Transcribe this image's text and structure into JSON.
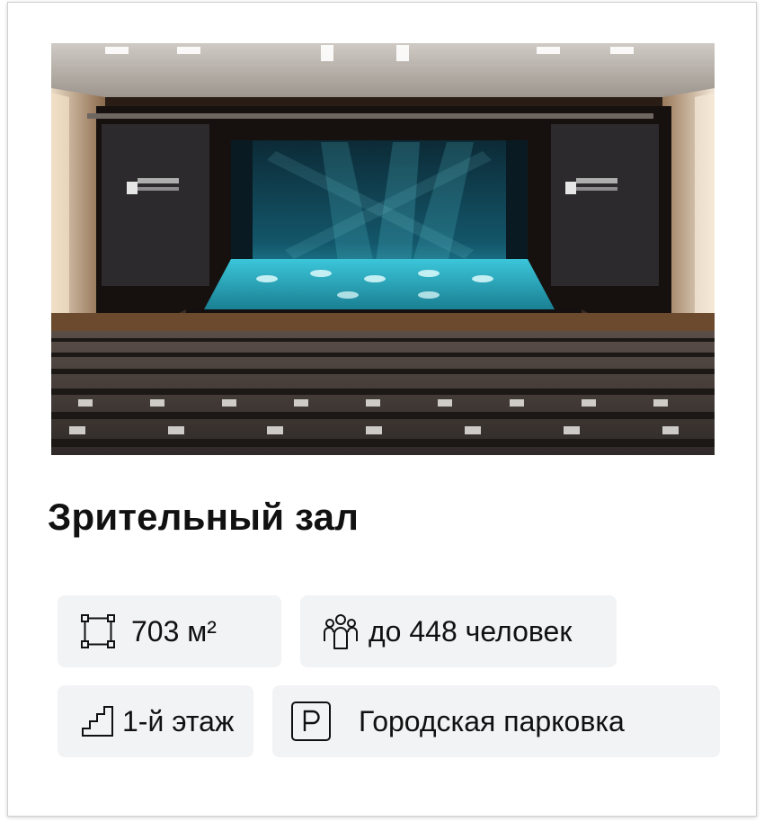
{
  "venue": {
    "photo_alt": "Зрительный зал",
    "title": "Зрительный зал"
  },
  "features": {
    "area": {
      "icon": "area-square-icon",
      "label": "703 м²"
    },
    "capacity": {
      "icon": "people-group-icon",
      "label": "до 448 человек"
    },
    "floor": {
      "icon": "stairs-icon",
      "label": "1-й этаж"
    },
    "parking": {
      "icon": "parking-icon",
      "label": "Городская парковка"
    }
  },
  "colors": {
    "chip_background": "#f2f3f5",
    "text": "#111111",
    "stage_light": "#3fc4d8"
  }
}
